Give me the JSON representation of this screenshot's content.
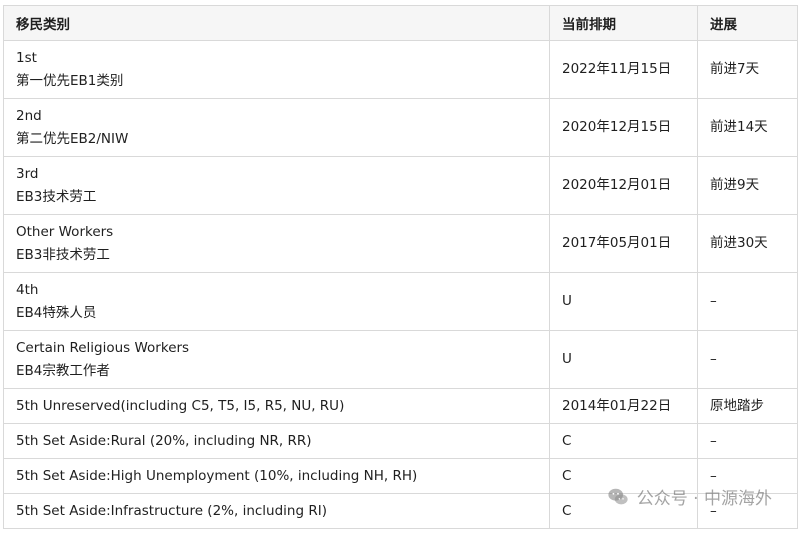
{
  "header": {
    "category": "移民类别",
    "date": "当前排期",
    "progress": "进展"
  },
  "rows": [
    {
      "line1": "1st",
      "line2": "第一优先EB1类别",
      "date": "2022年11月15日",
      "progress": "前进7天"
    },
    {
      "line1": "2nd",
      "line2": "第二优先EB2/NIW",
      "date": "2020年12月15日",
      "progress": "前进14天"
    },
    {
      "line1": "3rd",
      "line2": "EB3技术劳工",
      "date": "2020年12月01日",
      "progress": "前进9天"
    },
    {
      "line1": "Other Workers",
      "line2": "EB3非技术劳工",
      "date": "2017年05月01日",
      "progress": "前进30天"
    },
    {
      "line1": "4th",
      "line2": "EB4特殊人员",
      "date": "U",
      "progress": "–"
    },
    {
      "line1": "Certain Religious Workers",
      "line2": "EB4宗教工作者",
      "date": "U",
      "progress": "–"
    },
    {
      "line1": "5th Unreserved(including C5, T5, I5, R5, NU, RU)",
      "date": "2014年01月22日",
      "progress": "原地踏步"
    },
    {
      "line1": "5th Set Aside:Rural (20%, including NR, RR)",
      "date": "C",
      "progress": "–"
    },
    {
      "line1": "5th Set Aside:High Unemployment (10%, including NH, RH)",
      "date": "C",
      "progress": "–"
    },
    {
      "line1": "5th Set Aside:Infrastructure (2%, including RI)",
      "date": "C",
      "progress": "–"
    }
  ],
  "watermark": {
    "text": "公众号 · 中源海外",
    "icon": "wechat-icon"
  }
}
